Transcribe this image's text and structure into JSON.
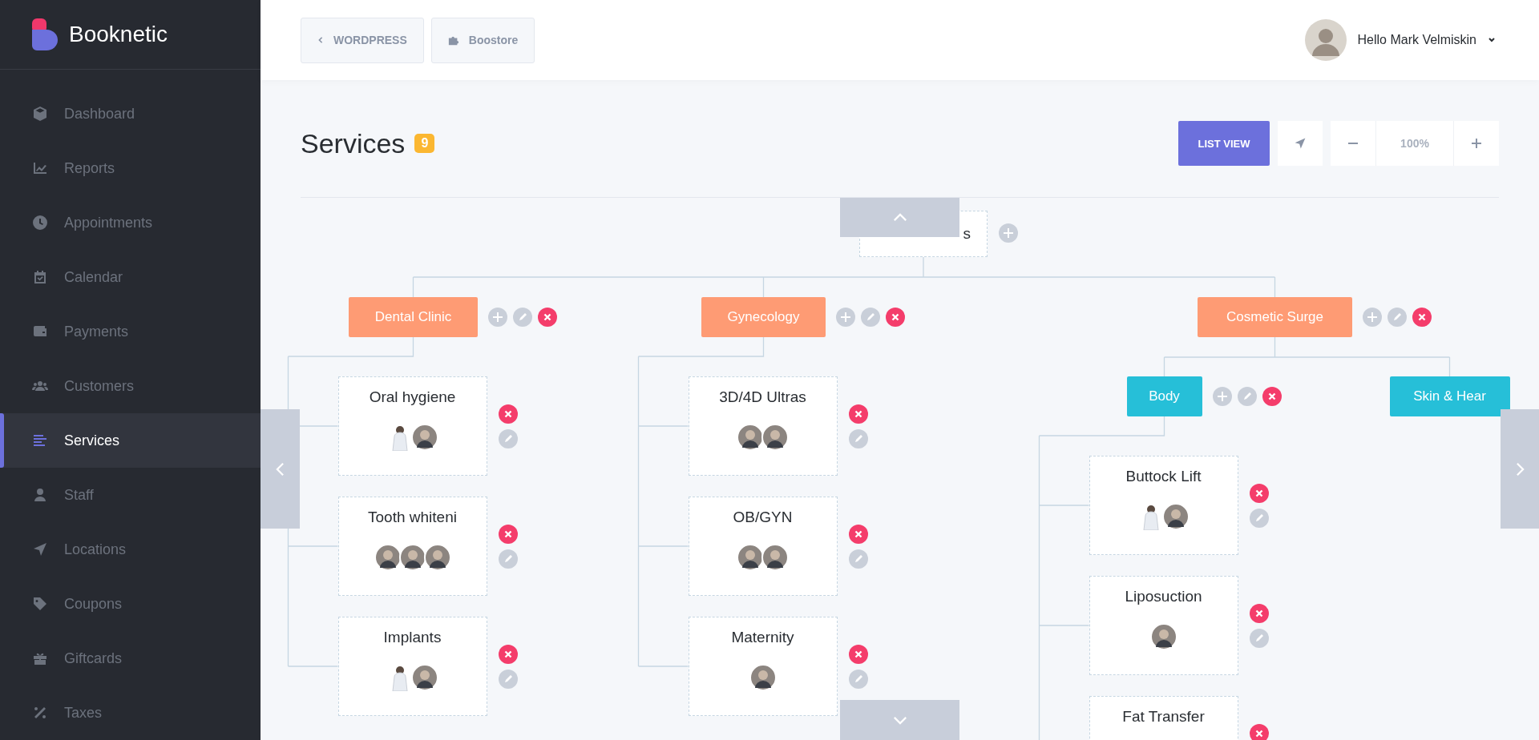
{
  "sidebar": {
    "brand": "Booknetic",
    "items": [
      {
        "label": "Dashboard",
        "selected": false
      },
      {
        "label": "Reports",
        "selected": false
      },
      {
        "label": "Appointments",
        "selected": false
      },
      {
        "label": "Calendar",
        "selected": false
      },
      {
        "label": "Payments",
        "selected": false
      },
      {
        "label": "Customers",
        "selected": false
      },
      {
        "label": "Services",
        "selected": true
      },
      {
        "label": "Staff",
        "selected": false
      },
      {
        "label": "Locations",
        "selected": false
      },
      {
        "label": "Coupons",
        "selected": false
      },
      {
        "label": "Giftcards",
        "selected": false
      },
      {
        "label": "Taxes",
        "selected": false
      }
    ]
  },
  "topbar": {
    "buttons": [
      "WORDPRESS",
      "Boostore"
    ],
    "user": "Hello Mark Velmiskin"
  },
  "page": {
    "title": "Services",
    "count": "9",
    "list_view": "LIST VIEW",
    "zoom": "100%"
  },
  "tree": {
    "root": {
      "label": "s"
    },
    "children": [
      {
        "label": "Dental Clinic",
        "children": [
          {
            "kind": "service",
            "label": "Oral hygiene",
            "staff": [
              {
                "kind": "cutout"
              },
              {
                "kind": "photo"
              }
            ]
          },
          {
            "kind": "service",
            "label": "Tooth whiteni",
            "staff": [
              {
                "kind": "photo"
              },
              {
                "kind": "photo"
              },
              {
                "kind": "photo"
              }
            ]
          },
          {
            "kind": "service",
            "label": "Implants",
            "staff": [
              {
                "kind": "cutout"
              },
              {
                "kind": "photo"
              }
            ]
          }
        ]
      },
      {
        "label": "Gynecology",
        "children": [
          {
            "kind": "service",
            "label": "3D/4D Ultras",
            "staff": [
              {
                "kind": "photo"
              },
              {
                "kind": "photo"
              }
            ]
          },
          {
            "kind": "service",
            "label": "OB/GYN",
            "staff": [
              {
                "kind": "photo"
              },
              {
                "kind": "photo"
              }
            ]
          },
          {
            "kind": "service",
            "label": "Maternity",
            "staff": [
              {
                "kind": "photo"
              }
            ]
          }
        ]
      },
      {
        "label": "Cosmetic Surge",
        "children": [
          {
            "kind": "category",
            "label": "Body",
            "children": [
              {
                "kind": "service",
                "label": "Buttock Lift",
                "staff": [
                  {
                    "kind": "cutout"
                  },
                  {
                    "kind": "photo"
                  }
                ]
              },
              {
                "kind": "service",
                "label": "Liposuction",
                "staff": [
                  {
                    "kind": "photo"
                  }
                ]
              },
              {
                "kind": "service",
                "label": "Fat Transfer"
              }
            ]
          },
          {
            "kind": "category",
            "label": "Skin & Hear"
          }
        ]
      }
    ]
  }
}
